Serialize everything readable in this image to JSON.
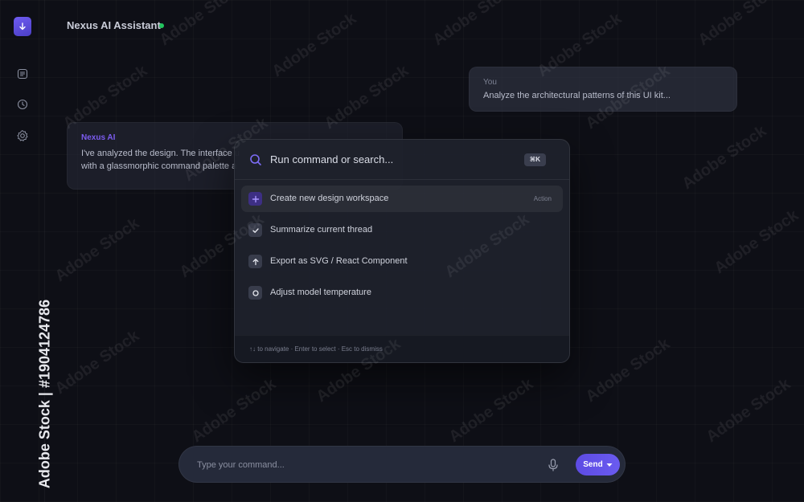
{
  "app": {
    "title": "Nexus AI Assistant",
    "status_color": "#22c55e",
    "accent_color": "#6a5bf0"
  },
  "sidebar": {
    "logo_icon": "download-arrow-icon",
    "items": [
      {
        "icon": "document-icon"
      },
      {
        "icon": "clock-icon"
      },
      {
        "icon": "gear-icon"
      }
    ]
  },
  "messages": [
    {
      "sender": "You",
      "text": "Analyze the architectural patterns of this UI kit..."
    },
    {
      "sender": "Nexus AI",
      "line1": "I've analyzed the design. The interface u",
      "line2": "with a glassmorphic command palette a"
    }
  ],
  "palette": {
    "search_text": "Run command or search...",
    "shortcut": "⌘K",
    "items": [
      {
        "label": "Create new design workspace",
        "tag": "Action",
        "icon": "plus-icon",
        "active": true
      },
      {
        "label": "Summarize current thread",
        "icon": "check-icon"
      },
      {
        "label": "Export as SVG / React Component",
        "icon": "arrow-up-icon"
      },
      {
        "label": "Adjust model temperature",
        "icon": "circle-icon"
      }
    ],
    "footer_hint": "↑↓ to navigate · Enter to select · Esc to dismiss"
  },
  "input": {
    "placeholder": "Type your command...",
    "send_label": "Send"
  },
  "watermark": {
    "text": "Adobe Stock",
    "side_text": "Adobe Stock | #1904124786"
  }
}
